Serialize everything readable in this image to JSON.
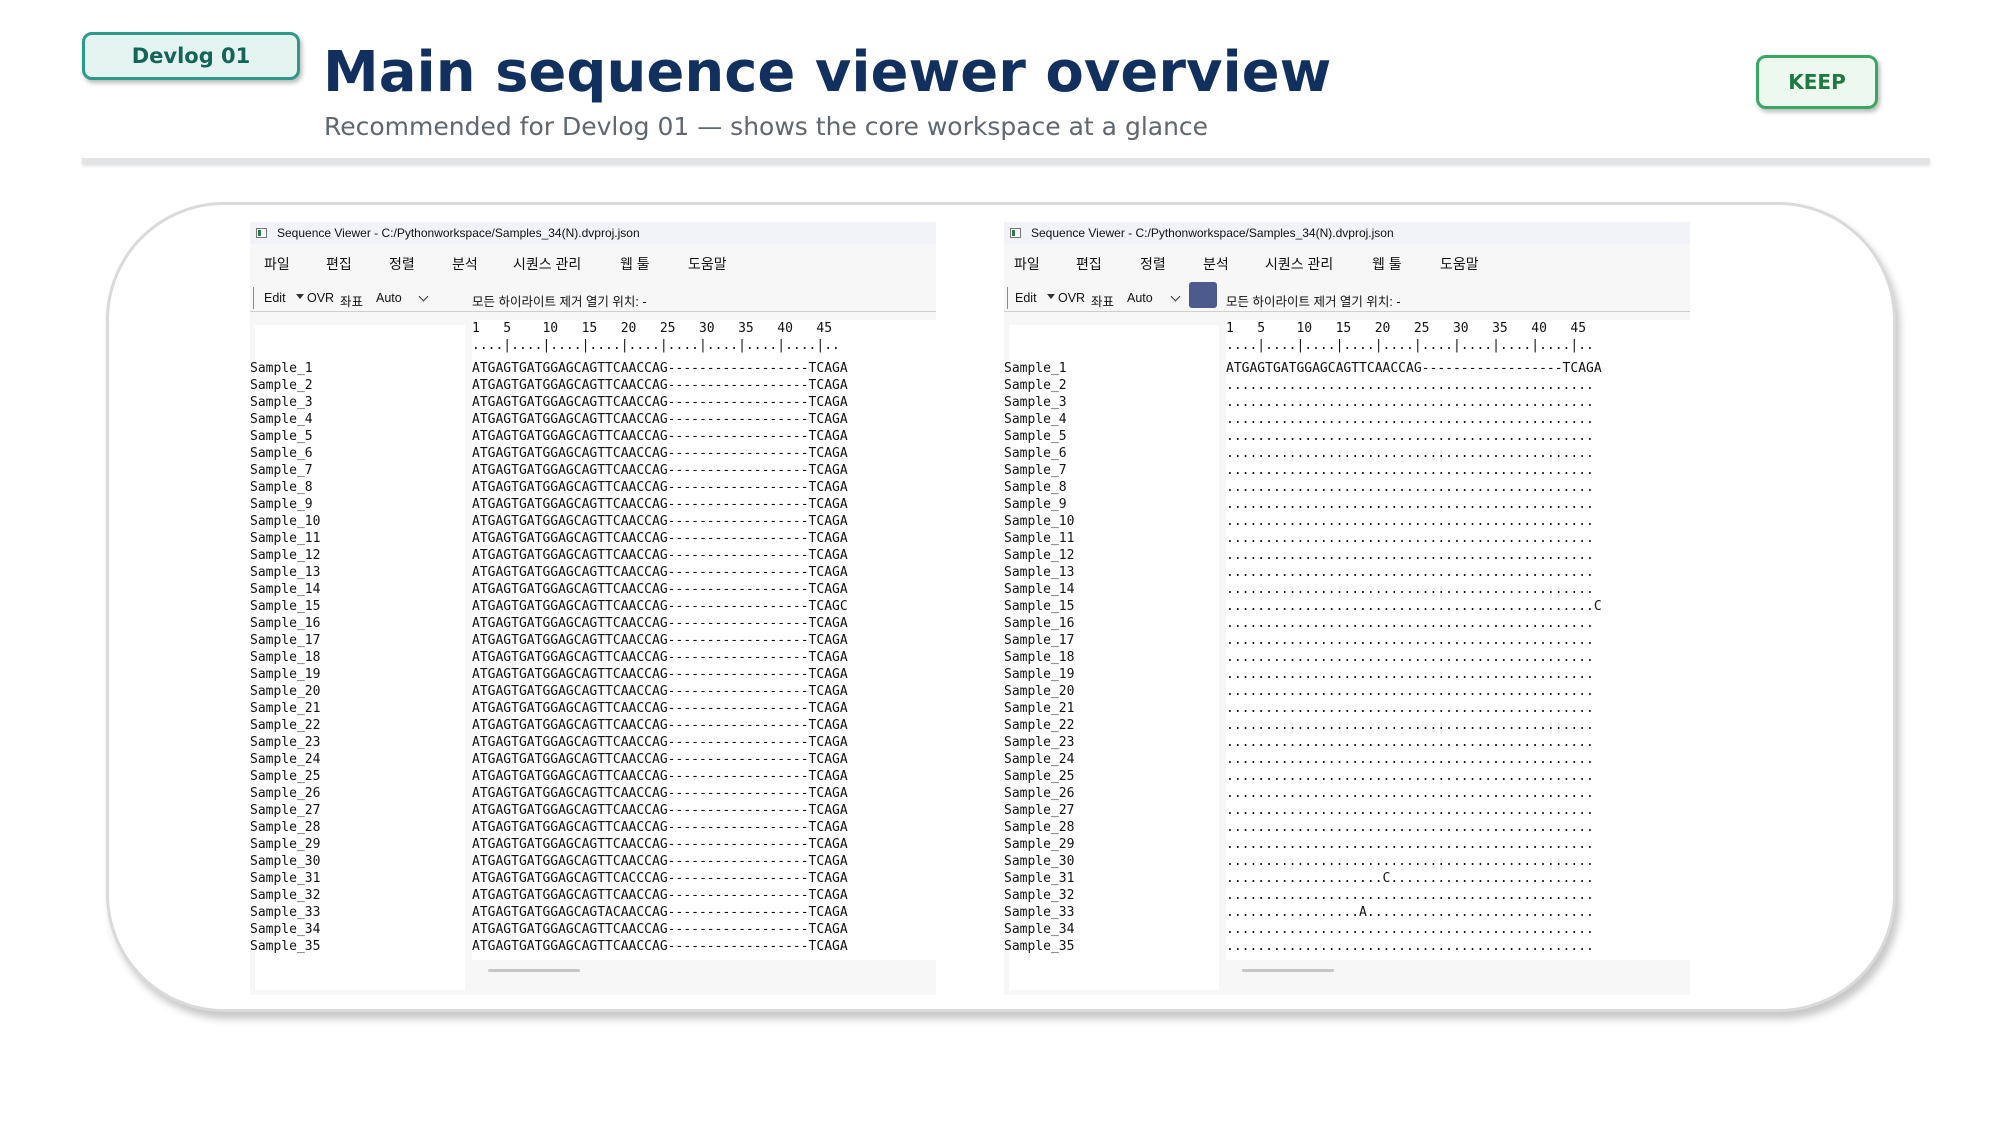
{
  "header": {
    "tag": "Devlog 01",
    "title": "Main sequence viewer overview",
    "subtitle": "Recommended for Devlog 01 — shows the core workspace at a glance",
    "badge": "KEEP"
  },
  "app": {
    "window_title": "Sequence Viewer - C:/Pythonworkspace/Samples_34(N).dvproj.json",
    "menu": [
      "파일",
      "편집",
      "정렬",
      "분석",
      "시퀀스 관리",
      "웹 툴",
      "도움말"
    ],
    "toolbar": {
      "mode": "Edit",
      "ovr": "OVR",
      "coord_label": "좌표",
      "coord_value": "Auto",
      "status": "모든 하이라이트 제거  열기 위치: -"
    },
    "ruler_numbers": "1   5    10   15   20   25   30   35   40   45",
    "ruler_ticks": "....|....|....|....|....|....|....|....|....|..",
    "samples": [
      "Sample_1",
      "Sample_2",
      "Sample_3",
      "Sample_4",
      "Sample_5",
      "Sample_6",
      "Sample_7",
      "Sample_8",
      "Sample_9",
      "Sample_10",
      "Sample_11",
      "Sample_12",
      "Sample_13",
      "Sample_14",
      "Sample_15",
      "Sample_16",
      "Sample_17",
      "Sample_18",
      "Sample_19",
      "Sample_20",
      "Sample_21",
      "Sample_22",
      "Sample_23",
      "Sample_24",
      "Sample_25",
      "Sample_26",
      "Sample_27",
      "Sample_28",
      "Sample_29",
      "Sample_30",
      "Sample_31",
      "Sample_32",
      "Sample_33",
      "Sample_34",
      "Sample_35"
    ],
    "left_sequences": [
      "ATGAGTGATGGAGCAGTTCAACCAG------------------TCAGA",
      "ATGAGTGATGGAGCAGTTCAACCAG------------------TCAGA",
      "ATGAGTGATGGAGCAGTTCAACCAG------------------TCAGA",
      "ATGAGTGATGGAGCAGTTCAACCAG------------------TCAGA",
      "ATGAGTGATGGAGCAGTTCAACCAG------------------TCAGA",
      "ATGAGTGATGGAGCAGTTCAACCAG------------------TCAGA",
      "ATGAGTGATGGAGCAGTTCAACCAG------------------TCAGA",
      "ATGAGTGATGGAGCAGTTCAACCAG------------------TCAGA",
      "ATGAGTGATGGAGCAGTTCAACCAG------------------TCAGA",
      "ATGAGTGATGGAGCAGTTCAACCAG------------------TCAGA",
      "ATGAGTGATGGAGCAGTTCAACCAG------------------TCAGA",
      "ATGAGTGATGGAGCAGTTCAACCAG------------------TCAGA",
      "ATGAGTGATGGAGCAGTTCAACCAG------------------TCAGA",
      "ATGAGTGATGGAGCAGTTCAACCAG------------------TCAGA",
      "ATGAGTGATGGAGCAGTTCAACCAG------------------TCAGC",
      "ATGAGTGATGGAGCAGTTCAACCAG------------------TCAGA",
      "ATGAGTGATGGAGCAGTTCAACCAG------------------TCAGA",
      "ATGAGTGATGGAGCAGTTCAACCAG------------------TCAGA",
      "ATGAGTGATGGAGCAGTTCAACCAG------------------TCAGA",
      "ATGAGTGATGGAGCAGTTCAACCAG------------------TCAGA",
      "ATGAGTGATGGAGCAGTTCAACCAG------------------TCAGA",
      "ATGAGTGATGGAGCAGTTCAACCAG------------------TCAGA",
      "ATGAGTGATGGAGCAGTTCAACCAG------------------TCAGA",
      "ATGAGTGATGGAGCAGTTCAACCAG------------------TCAGA",
      "ATGAGTGATGGAGCAGTTCAACCAG------------------TCAGA",
      "ATGAGTGATGGAGCAGTTCAACCAG------------------TCAGA",
      "ATGAGTGATGGAGCAGTTCAACCAG------------------TCAGA",
      "ATGAGTGATGGAGCAGTTCAACCAG------------------TCAGA",
      "ATGAGTGATGGAGCAGTTCAACCAG------------------TCAGA",
      "ATGAGTGATGGAGCAGTTCAACCAG------------------TCAGA",
      "ATGAGTGATGGAGCAGTTCACCCAG------------------TCAGA",
      "ATGAGTGATGGAGCAGTTCAACCAG------------------TCAGA",
      "ATGAGTGATGGAGCAGTACAACCAG------------------TCAGA",
      "ATGAGTGATGGAGCAGTTCAACCAG------------------TCAGA",
      "ATGAGTGATGGAGCAGTTCAACCAG------------------TCAGA"
    ],
    "right_sequences": [
      "ATGAGTGATGGAGCAGTTCAACCAG------------------TCAGA",
      "...............................................",
      "...............................................",
      "...............................................",
      "...............................................",
      "...............................................",
      "...............................................",
      "...............................................",
      "...............................................",
      "...............................................",
      "...............................................",
      "...............................................",
      "...............................................",
      "...............................................",
      "...............................................C",
      "...............................................",
      "...............................................",
      "...............................................",
      "...............................................",
      "...............................................",
      "...............................................",
      "...............................................",
      "...............................................",
      "...............................................",
      "...............................................",
      "...............................................",
      "...............................................",
      "...............................................",
      "...............................................",
      "...............................................",
      "....................C..........................",
      "...............................................",
      ".................A.............................",
      "...............................................",
      "..............................................."
    ]
  },
  "colors": {
    "title": "#12305e",
    "tag_border": "#2b9a8a",
    "keep_border": "#3aa864",
    "highlight_swatch": "#4d5a8c"
  }
}
